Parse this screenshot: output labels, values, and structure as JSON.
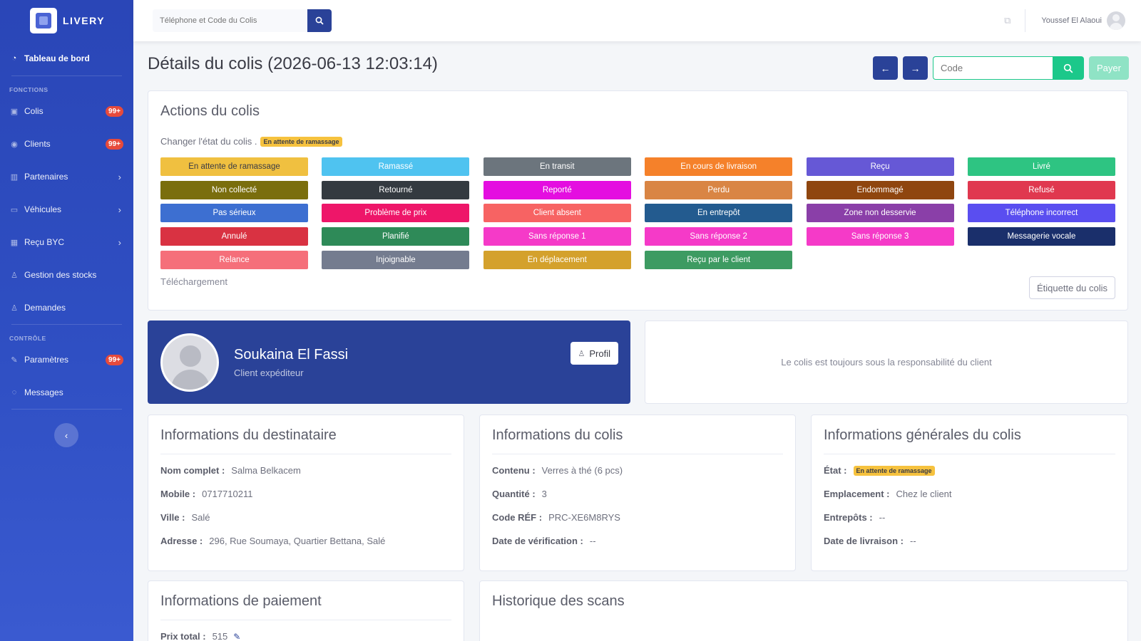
{
  "colors": {
    "primary": "#2a4298",
    "success": "#1cc88a",
    "warning": "#f6c23e",
    "danger": "#e74a3b"
  },
  "brand": {
    "name": "LIVERY"
  },
  "sidebar": {
    "dashboard": {
      "label": "Tableau de bord",
      "icon": "dashboard-icon"
    },
    "heading_functions": "FONCTIONS",
    "heading_control": "CONTRÔLE",
    "items": [
      {
        "label": "Colis",
        "badge": "99+",
        "icon": "box-icon"
      },
      {
        "label": "Clients",
        "badge": "99+",
        "icon": "user-circle-icon"
      },
      {
        "label": "Partenaires",
        "icon": "building-icon"
      },
      {
        "label": "Véhicules",
        "icon": "truck-icon"
      },
      {
        "label": "Reçu BYC",
        "icon": "grid-icon"
      },
      {
        "label": "Gestion des stocks",
        "icon": "user-icon"
      },
      {
        "label": "Demandes",
        "icon": "user-icon"
      },
      {
        "label": "Paramètres",
        "badge": "99+",
        "icon": "wrench-icon"
      },
      {
        "label": "Messages",
        "icon": "chat-icon"
      }
    ]
  },
  "topbar": {
    "search_placeholder": "Téléphone et Code du Colis",
    "user_name": "Youssef El Alaoui"
  },
  "page": {
    "title": "Détails du colis (2026-06-13 12:03:14)",
    "code_placeholder": "Code",
    "pay_label": "Payer",
    "prev_label": "←",
    "next_label": "→"
  },
  "actions": {
    "title": "Actions du colis",
    "change_state_label": "Changer l'état du colis .",
    "current_state": "En attente de ramassage",
    "download_label": "Téléchargement",
    "label_button": "Étiquette du colis",
    "status_buttons": [
      {
        "label": "En attente de ramassage",
        "color": "#f0c040",
        "text": "#3a3b45"
      },
      {
        "label": "Ramassé",
        "color": "#4fc3f0",
        "text": "#ffffff"
      },
      {
        "label": "En transit",
        "color": "#6c757d",
        "text": "#ffffff"
      },
      {
        "label": "En cours de livraison",
        "color": "#f5812a",
        "text": "#ffffff"
      },
      {
        "label": "Reçu",
        "color": "#6658d6",
        "text": "#ffffff"
      },
      {
        "label": "Livré",
        "color": "#2ec482",
        "text": "#ffffff"
      },
      {
        "label": "Non collecté",
        "color": "#7a6e0d",
        "text": "#ffffff"
      },
      {
        "label": "Retourné",
        "color": "#343a40",
        "text": "#ffffff"
      },
      {
        "label": "Reporté",
        "color": "#e40ee0",
        "text": "#ffffff"
      },
      {
        "label": "Perdu",
        "color": "#d98544",
        "text": "#ffffff"
      },
      {
        "label": "Endommagé",
        "color": "#8f460f",
        "text": "#ffffff"
      },
      {
        "label": "Refusé",
        "color": "#e0384f",
        "text": "#ffffff"
      },
      {
        "label": "Pas sérieux",
        "color": "#3d6fd1",
        "text": "#ffffff"
      },
      {
        "label": "Problème de prix",
        "color": "#ee1669",
        "text": "#ffffff"
      },
      {
        "label": "Client absent",
        "color": "#f76363",
        "text": "#ffffff"
      },
      {
        "label": "En entrepôt",
        "color": "#235b8f",
        "text": "#ffffff"
      },
      {
        "label": "Zone non desservie",
        "color": "#8a3fa8",
        "text": "#ffffff"
      },
      {
        "label": "Téléphone incorrect",
        "color": "#5a4ef0",
        "text": "#ffffff"
      },
      {
        "label": "Annulé",
        "color": "#d93242",
        "text": "#ffffff"
      },
      {
        "label": "Planifié",
        "color": "#2e8a58",
        "text": "#ffffff"
      },
      {
        "label": "Sans réponse 1",
        "color": "#f53ac8",
        "text": "#ffffff"
      },
      {
        "label": "Sans réponse 2",
        "color": "#f53ac8",
        "text": "#ffffff"
      },
      {
        "label": "Sans réponse 3",
        "color": "#f53ac8",
        "text": "#ffffff"
      },
      {
        "label": "Messagerie vocale",
        "color": "#1a2f6b",
        "text": "#ffffff"
      },
      {
        "label": "Relance",
        "color": "#f56f7a",
        "text": "#ffffff"
      },
      {
        "label": "Injoignable",
        "color": "#747c8f",
        "text": "#ffffff"
      },
      {
        "label": "En déplacement",
        "color": "#d4a12c",
        "text": "#ffffff"
      },
      {
        "label": "Reçu par le client",
        "color": "#3d9b62",
        "text": "#ffffff"
      }
    ]
  },
  "sender": {
    "name": "Soukaina El Fassi",
    "role": "Client expéditeur",
    "profile_label": "Profil"
  },
  "responsibility": {
    "text": "Le colis est toujours sous la responsabilité du client"
  },
  "recipient": {
    "title": "Informations du destinataire",
    "rows": [
      {
        "label": "Nom complet :",
        "value": "Salma Belkacem"
      },
      {
        "label": "Mobile :",
        "value": "0717710211"
      },
      {
        "label": "Ville :",
        "value": "Salé"
      },
      {
        "label": "Adresse :",
        "value": "296, Rue Soumaya, Quartier Bettana, Salé"
      }
    ]
  },
  "parcel": {
    "title": "Informations du colis",
    "rows": [
      {
        "label": "Contenu :",
        "value": "Verres à thé (6 pcs)"
      },
      {
        "label": "Quantité :",
        "value": "3"
      },
      {
        "label": "Code RÉF :",
        "value": "PRC-XE6M8RYS"
      },
      {
        "label": "Date de vérification :",
        "value": "--"
      }
    ]
  },
  "general": {
    "title": "Informations générales du colis",
    "state_label": "État :",
    "state_value": "En attente de ramassage",
    "rows": [
      {
        "label": "Emplacement :",
        "value": "Chez le client"
      },
      {
        "label": "Entrepôts :",
        "value": "--"
      },
      {
        "label": "Date de livraison :",
        "value": "--"
      }
    ]
  },
  "payment": {
    "title": "Informations de paiement",
    "total_label": "Prix total :",
    "total_value": "515"
  },
  "scans": {
    "title": "Historique des scans"
  }
}
